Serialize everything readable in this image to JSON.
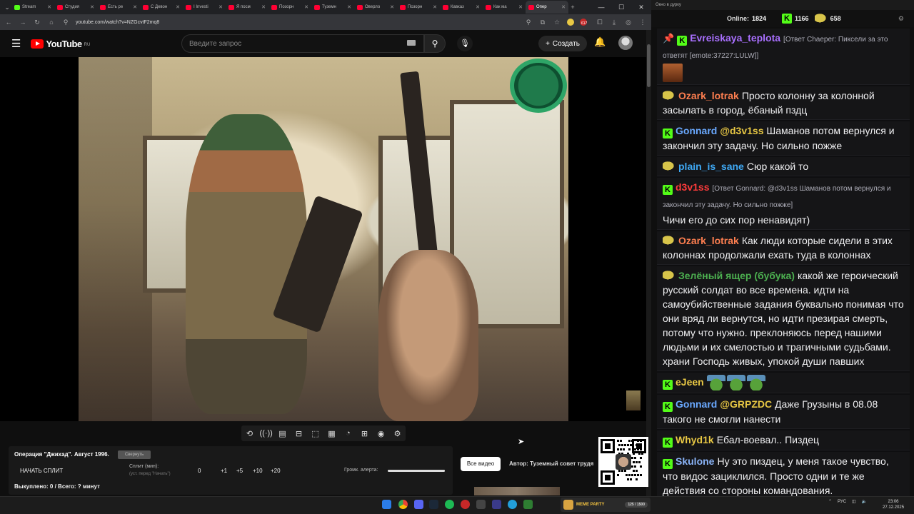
{
  "browser": {
    "tabs": [
      {
        "label": "Stream",
        "color": "#53fc18"
      },
      {
        "label": "Студия",
        "color": "#ff0033"
      },
      {
        "label": "Есть ре",
        "color": "#ff0033"
      },
      {
        "label": "С Девон",
        "color": "#ff0033"
      },
      {
        "label": "I Investi",
        "color": "#ff0033"
      },
      {
        "label": "Я посм",
        "color": "#ff0033"
      },
      {
        "label": "Позорн",
        "color": "#ff0033"
      },
      {
        "label": "Туземн",
        "color": "#ff0033"
      },
      {
        "label": "Оверло",
        "color": "#ff0033"
      },
      {
        "label": "Позорн",
        "color": "#ff0033"
      },
      {
        "label": "Кавказ",
        "color": "#ff0033"
      },
      {
        "label": "Как ма",
        "color": "#ff0033"
      },
      {
        "label": "Опер",
        "color": "#ff0033"
      }
    ],
    "url": "youtube.com/watch?v=NZGcvtF2mq8",
    "ext_badge": "617"
  },
  "youtube": {
    "logo_text": "YouTube",
    "region": "RU",
    "search_placeholder": "Введите запрос",
    "create_label": "Создать"
  },
  "player_tools": [
    "⟲",
    "((·))",
    "▤",
    "⊟",
    "⬚",
    "▦",
    "◔",
    "⊞",
    "◉",
    "⚙"
  ],
  "panel": {
    "title": "Операция \"Джихад\". Август 1996.",
    "hide_label": "Свернуть",
    "split_button": "НАЧАТЬ СПЛИТ",
    "split_label": "Сплит (мин):",
    "split_hint": "(уст. перед \"Начать\")",
    "split_values": [
      "0",
      "+1",
      "+5",
      "+10",
      "+20"
    ],
    "volume_label": "Громк. алерта:",
    "volume_level": 1.0,
    "bought": "Выкуплено: 0 / Всего: ? минут",
    "all_videos": "Все видео",
    "author": "Автор: Туземный совет трудя"
  },
  "chat": {
    "window_title": "Окно в дурку",
    "online_label": "Online:",
    "online_count": "1824",
    "kick_count": "1166",
    "pepe_count": "658",
    "messages": [
      {
        "badge": "pin-k",
        "user": "Evreiskaya_teplota",
        "color": "#a970ff",
        "reply": "[Ответ Chaeper: Пиксели за это ответят [emote:37227:LULW]]",
        "text": "",
        "emote": true
      },
      {
        "badge": "pepe",
        "user": "Ozark_lotrak",
        "color": "#ff7f50",
        "text": "Просто колонну за колонной засылать в город, ёбаный пздц"
      },
      {
        "badge": "k",
        "user": "Gonnard",
        "color": "#6aa9ff",
        "mention": "@d3v1ss",
        "text": "Шаманов потом вернулся и закончил эту задачу. Но сильно пожже"
      },
      {
        "badge": "pepe",
        "user": "plain_is_sane",
        "color": "#3fa9f5",
        "text": "Сюр какой то"
      },
      {
        "badge": "k",
        "user": "d3v1ss",
        "color": "#ff3b3b",
        "reply": "[Ответ Gonnard: @d3v1ss Шаманов потом вернулся и закончил эту задачу. Но сильно пожже]",
        "text": "Чичи его до сих пор ненавидят)"
      },
      {
        "badge": "pepe",
        "user": "Ozark_lotrak",
        "color": "#ff7f50",
        "text": "Как люди которые сидели в этих колоннах продолжали ехать туда в колоннах"
      },
      {
        "badge": "pepe",
        "user": "Зелёный ящер (бубука)",
        "color": "#4caf50",
        "text": "какой же героический русский солдат во все времена. идти на самоубийственные задания буквально понимая что они вряд ли вернутся, но идти презирая смерть, потому что нужно. преклоняюсь перед нашими людьми и их смелостью и трагичными судьбами. храни Господь живых, упокой души павших"
      },
      {
        "badge": "k",
        "user": "eJeen",
        "color": "#e8c844",
        "text": "",
        "pepes": 3
      },
      {
        "badge": "k",
        "user": "Gonnard",
        "color": "#6aa9ff",
        "mention": "@GRPZDC",
        "text": "Даже Грузыны в 08.08 такого не смогли нанести"
      },
      {
        "badge": "k",
        "user": "Whyd1k",
        "color": "#e8c844",
        "text": "Ебал-воевал.. Пиздец"
      },
      {
        "badge": "k",
        "user": "Skulone",
        "color": "#8ab4f8",
        "text": "Ну это пиздец, у меня такое чувство, что видос зациклился. Просто одни и те же действия со стороны командования."
      }
    ]
  },
  "taskbar": {
    "meme_label": "MEME PARTY",
    "meme_progress": "125 / 1500",
    "lang": "РУС",
    "time": "23:06",
    "date": "27.12.2025"
  }
}
